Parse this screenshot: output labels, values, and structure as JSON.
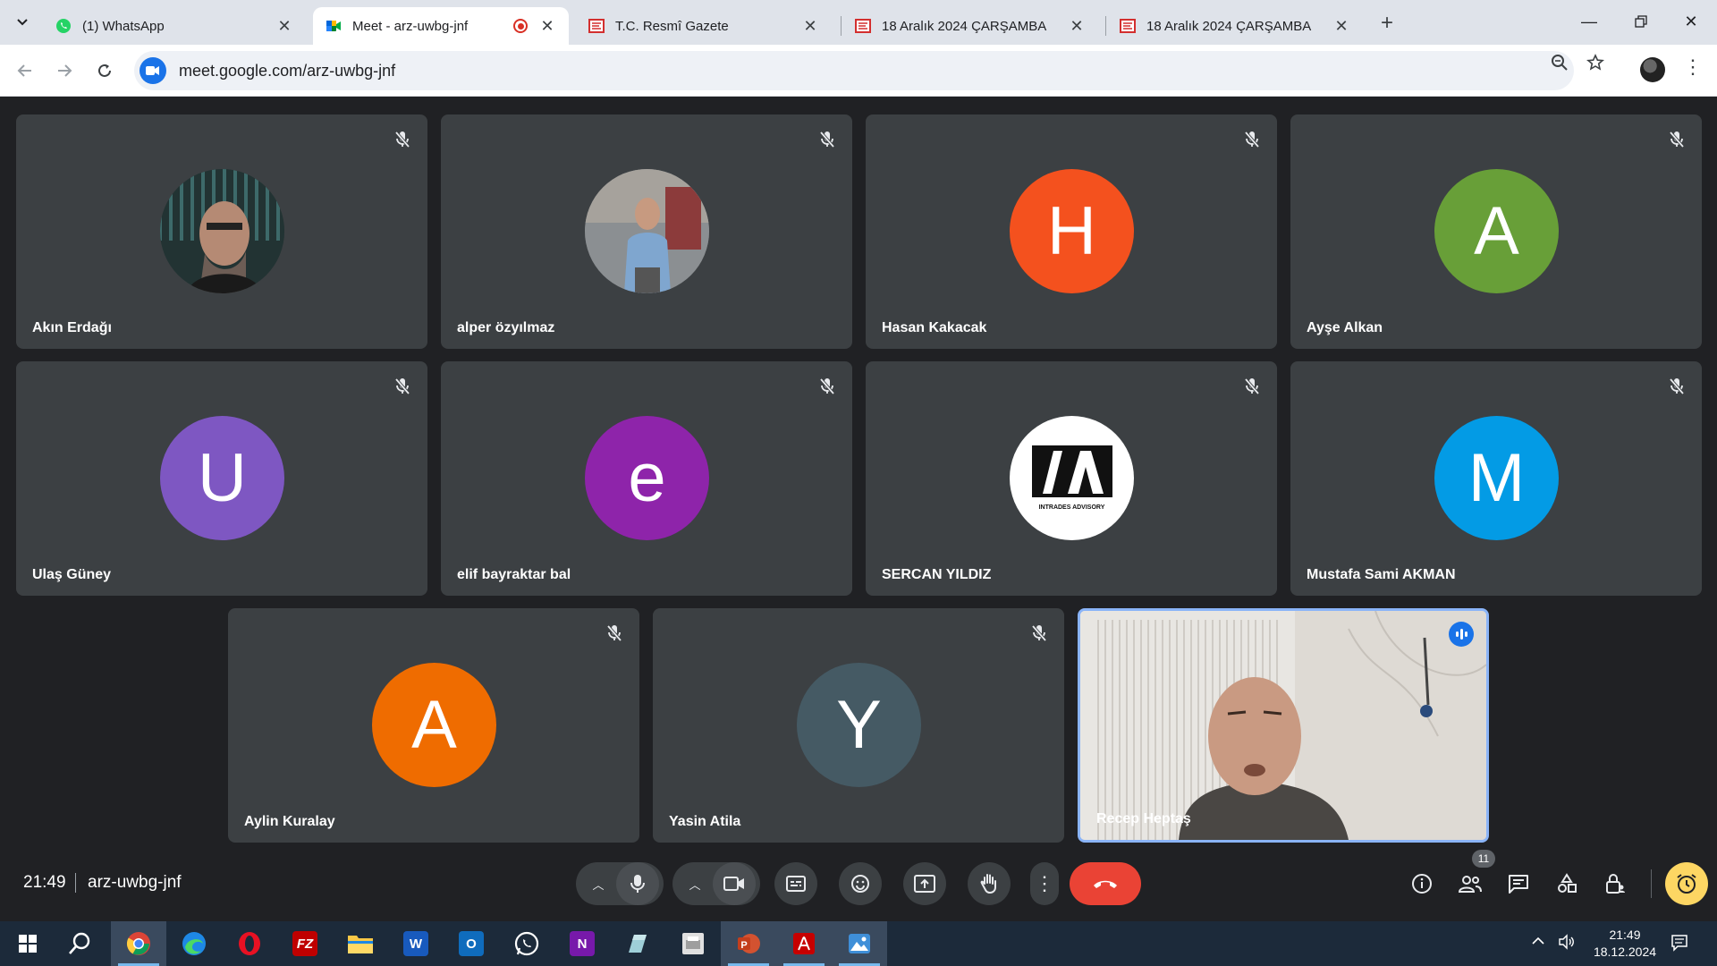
{
  "browser": {
    "tabs": [
      {
        "title": "(1) WhatsApp",
        "active": false
      },
      {
        "title": "Meet - arz-uwbg-jnf",
        "active": true,
        "recording": true
      },
      {
        "title": "T.C. Resmî Gazete",
        "active": false
      },
      {
        "title": "18 Aralık 2024 ÇARŞAMBA",
        "active": false
      },
      {
        "title": "18 Aralık 2024 ÇARŞAMBA",
        "active": false
      }
    ],
    "url": "meet.google.com/arz-uwbg-jnf"
  },
  "participants": [
    {
      "name": "Akın Erdağı",
      "type": "photo",
      "muted": true
    },
    {
      "name": "alper özyılmaz",
      "type": "photo",
      "muted": true
    },
    {
      "name": "Hasan Kakacak",
      "type": "initial",
      "initial": "H",
      "color": "#f4511e",
      "muted": true
    },
    {
      "name": "Ayşe Alkan",
      "type": "initial",
      "initial": "A",
      "color": "#689f38",
      "muted": true
    },
    {
      "name": "Ulaş Güney",
      "type": "initial",
      "initial": "U",
      "color": "#7e57c2",
      "muted": true
    },
    {
      "name": "elif bayraktar bal",
      "type": "initial",
      "initial": "e",
      "color": "#8e24aa",
      "muted": true
    },
    {
      "name": "SERCAN YILDIZ",
      "type": "logo",
      "logo_text": "INTRADES ADVISORY",
      "muted": true
    },
    {
      "name": "Mustafa Sami AKMAN",
      "type": "initial",
      "initial": "M",
      "color": "#039be5",
      "muted": true
    },
    {
      "name": "Aylin Kuralay",
      "type": "initial",
      "initial": "A",
      "color": "#ef6c00",
      "muted": true
    },
    {
      "name": "Yasin Atila",
      "type": "initial",
      "initial": "Y",
      "color": "#455a64",
      "muted": true
    },
    {
      "name": "Recep Heptaş",
      "type": "video",
      "speaking": true,
      "muted": false
    }
  ],
  "meeting": {
    "time": "21:49",
    "code": "arz-uwbg-jnf",
    "participant_count": "11"
  },
  "taskbar": {
    "time": "21:49",
    "date": "18.12.2024"
  },
  "colors": {
    "tile_bg": "#3c4043",
    "meet_bg": "#202124",
    "end_call": "#ea4335",
    "host_controls": "#fdd663"
  }
}
